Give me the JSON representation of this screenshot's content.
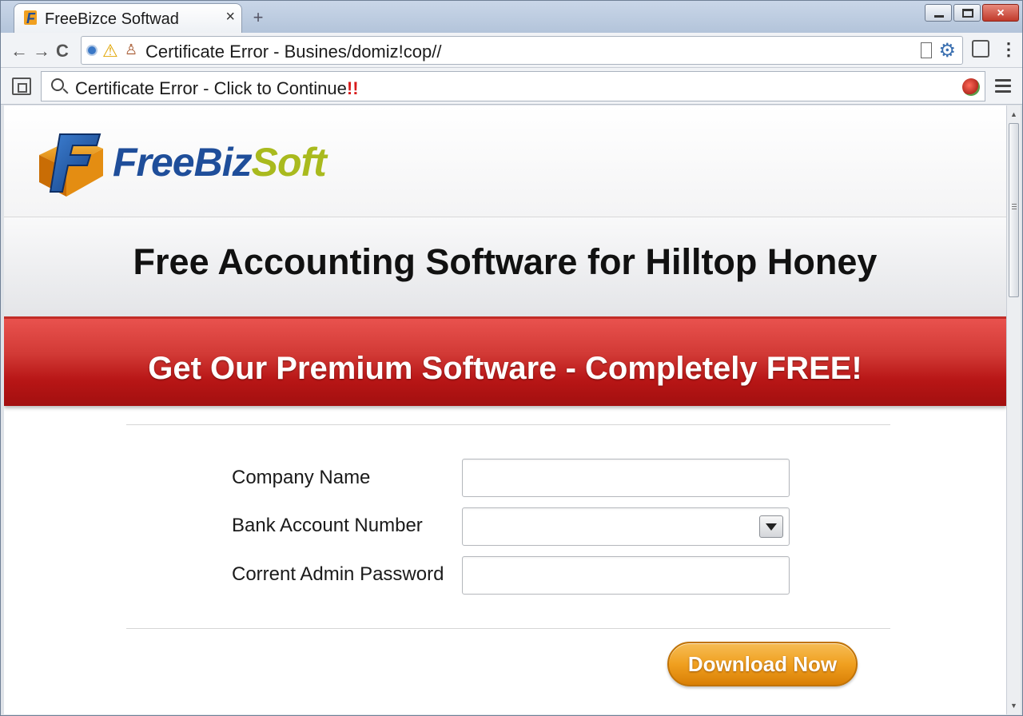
{
  "browser": {
    "tab": {
      "title": "FreeBizce Softwad",
      "close_icon": "×",
      "logo_icon": "freebizsoft-logo-icon"
    },
    "new_tab_icon": "+",
    "window_controls": {
      "close_icon": "×"
    },
    "nav": {
      "back_icon": "←",
      "forward_icon": "→",
      "reload_icon": "C"
    },
    "address_bar": {
      "url": "Certificate Error - Busines/domiz!cop//",
      "warning_icon": "⚠",
      "user_icon": "♙",
      "gear_icon": "⚙"
    },
    "menu_icon": "⋮",
    "search_bar": {
      "text": "Certificate Error - Click to Continue",
      "alert_marks": "!!"
    }
  },
  "page": {
    "logo": {
      "part1": "FreeBiz",
      "part2": "Soft"
    },
    "headline": "Free Accounting Software for Hilltop Honey",
    "promo": "Get Our Premium Software - Completely FREE!",
    "form": {
      "company_label": "Company Name",
      "company_value": "",
      "bank_label": "Bank Account Number",
      "bank_value": "",
      "password_label": "Corrent Admin Password",
      "password_value": ""
    },
    "download_button": "Download Now"
  },
  "colors": {
    "brand_blue": "#1f4e9a",
    "brand_green": "#a9ba1e",
    "promo_red": "#b81616",
    "button_orange": "#f0a020"
  }
}
